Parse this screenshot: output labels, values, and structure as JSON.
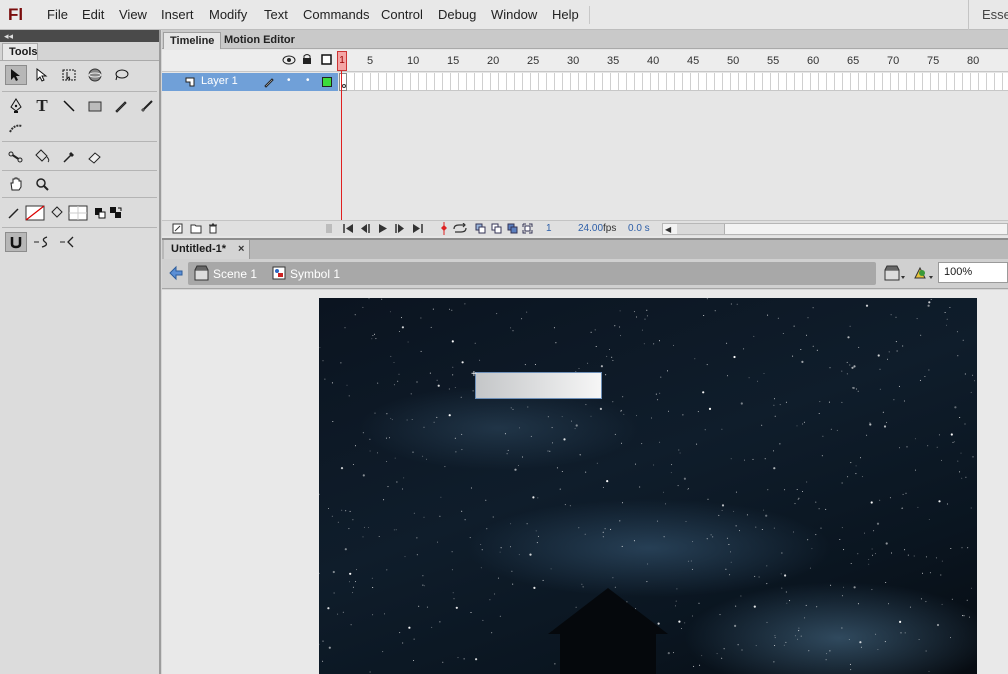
{
  "app": {
    "logo": "Fl",
    "workspace": "Esser"
  },
  "menu": [
    "File",
    "Edit",
    "View",
    "Insert",
    "Modify",
    "Text",
    "Commands",
    "Control",
    "Debug",
    "Window",
    "Help"
  ],
  "tools_panel": {
    "collapse_glyph": "◂◂",
    "tab_label": "Tools"
  },
  "timeline": {
    "tabs": [
      "Timeline",
      "Motion Editor"
    ],
    "active_tab": "Timeline",
    "ruler": [
      "1",
      "5",
      "10",
      "15",
      "20",
      "25",
      "30",
      "35",
      "40",
      "45",
      "50",
      "55",
      "60",
      "65",
      "70",
      "75",
      "80"
    ],
    "layer_name": "Layer 1",
    "current_frame": "1",
    "fps": "24.00",
    "fps_unit": "fps",
    "elapsed": "0.0 s"
  },
  "document": {
    "tab_label": "Untitled-1*",
    "close_glyph": "×",
    "scene": "Scene 1",
    "symbol": "Symbol 1",
    "zoom": "100%"
  },
  "colors": {
    "layer_highlight": "#70a0d8",
    "playhead": "#e02020",
    "logo": "#7a0c0c"
  }
}
